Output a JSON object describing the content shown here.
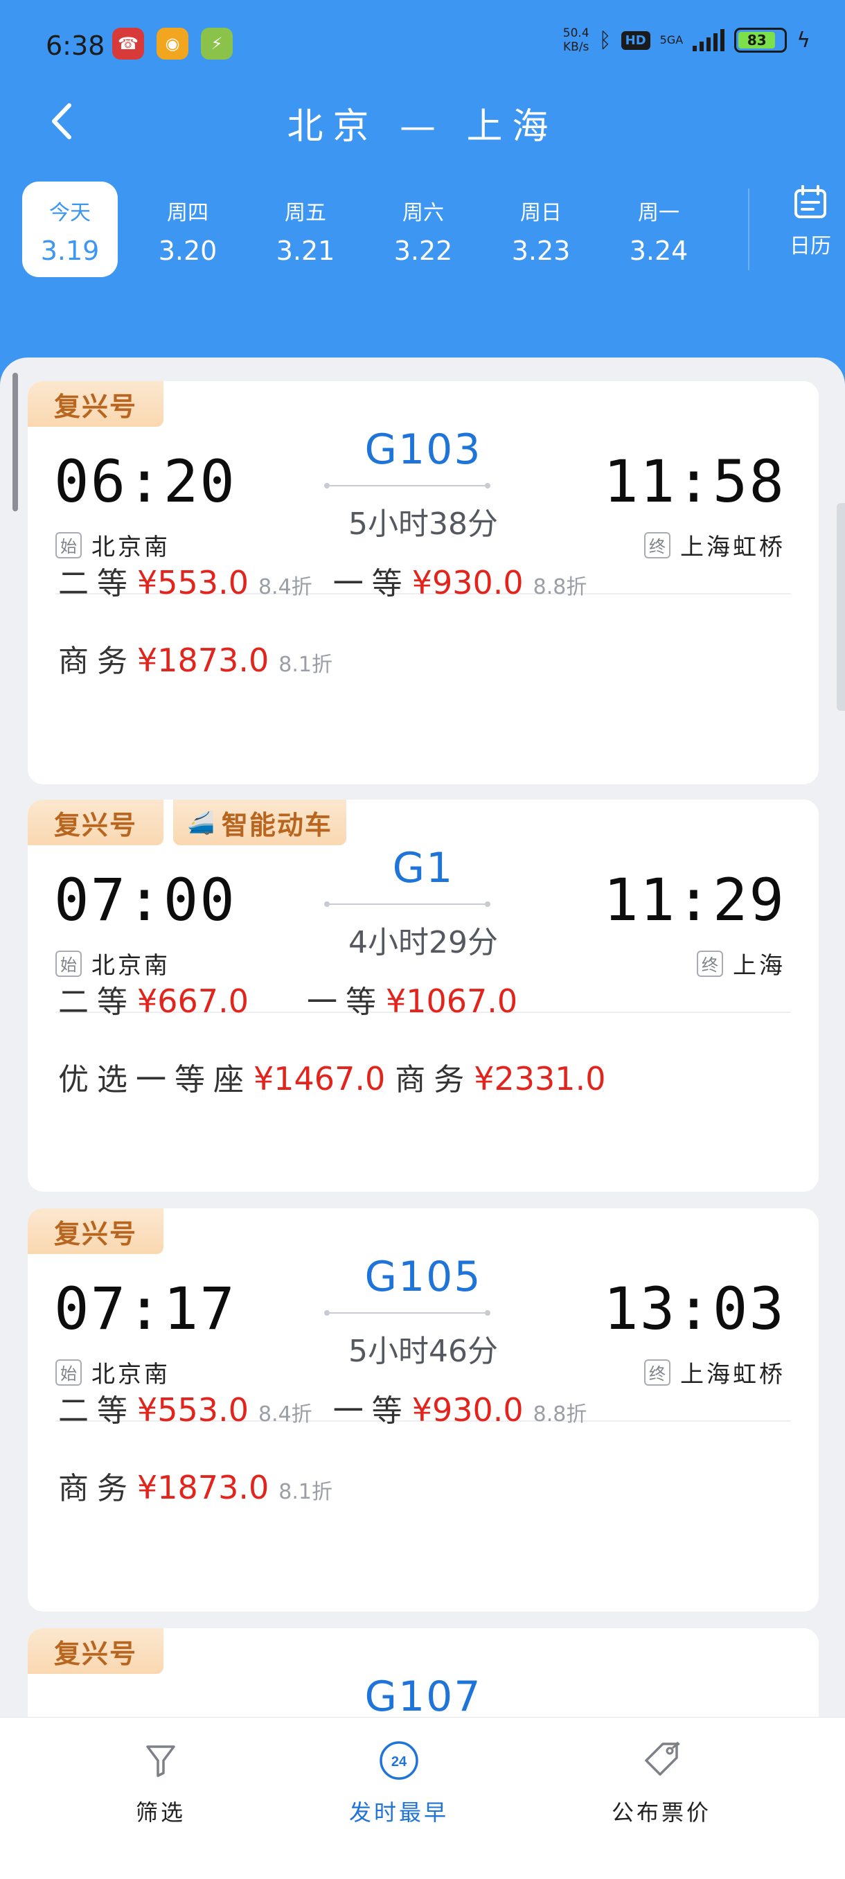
{
  "status_bar": {
    "time": "6:38",
    "net_speed_value": "50.4",
    "net_speed_unit": "KB/s",
    "hd": "HD",
    "network": "5GA",
    "battery": "83"
  },
  "header": {
    "title": "北京 — 上海"
  },
  "date_tabs": [
    {
      "dow": "今天",
      "date": "3.19",
      "selected": true
    },
    {
      "dow": "周四",
      "date": "3.20"
    },
    {
      "dow": "周五",
      "date": "3.21"
    },
    {
      "dow": "周六",
      "date": "3.22"
    },
    {
      "dow": "周日",
      "date": "3.23"
    },
    {
      "dow": "周一",
      "date": "3.24"
    }
  ],
  "calendar_label": "日历",
  "station_tags": {
    "start": "始",
    "end": "终"
  },
  "trains": [
    {
      "badges": [
        "复兴号"
      ],
      "departure": "06:20",
      "arrival": "11:58",
      "number": "G103",
      "duration": "5小时38分",
      "from": "北京南",
      "to": "上海虹桥",
      "prices": [
        [
          {
            "seat": "二等",
            "price": "¥553.0",
            "discount": "8.4折"
          },
          {
            "seat": "一等",
            "price": "¥930.0",
            "discount": "8.8折"
          }
        ],
        [
          {
            "seat": "商务",
            "price": "¥1873.0",
            "discount": "8.1折"
          }
        ]
      ]
    },
    {
      "badges": [
        "复兴号",
        "智能动车"
      ],
      "departure": "07:00",
      "arrival": "11:29",
      "number": "G1",
      "duration": "4小时29分",
      "from": "北京南",
      "to": "上海",
      "prices": [
        [
          {
            "seat": "二等",
            "price": "¥667.0"
          },
          {
            "seat": "一等",
            "price": "¥1067.0"
          }
        ],
        [
          {
            "seat": "优选一等座",
            "price": "¥1467.0"
          },
          {
            "seat": "商务",
            "price": "¥2331.0"
          }
        ]
      ]
    },
    {
      "badges": [
        "复兴号"
      ],
      "departure": "07:17",
      "arrival": "13:03",
      "number": "G105",
      "duration": "5小时46分",
      "from": "北京南",
      "to": "上海虹桥",
      "prices": [
        [
          {
            "seat": "二等",
            "price": "¥553.0",
            "discount": "8.4折"
          },
          {
            "seat": "一等",
            "price": "¥930.0",
            "discount": "8.8折"
          }
        ],
        [
          {
            "seat": "商务",
            "price": "¥1873.0",
            "discount": "8.1折"
          }
        ]
      ]
    },
    {
      "badges": [
        "复兴号"
      ],
      "number": "G107"
    }
  ],
  "bottom_bar": {
    "filter_label": "筛选",
    "earliest_label": "发时最早",
    "earliest_icon_text": "24",
    "price_label": "公布票价"
  },
  "colors": {
    "brand_blue": "#3d96f1",
    "price_red": "#e3241d",
    "train_number_blue": "#1f74d9",
    "badge_text": "#b8661f"
  },
  "icons": {
    "back": "chevron-left-icon",
    "calendar": "calendar-icon",
    "filter": "filter-funnel-icon",
    "earliest": "clock-24-icon",
    "price": "price-tag-icon"
  }
}
